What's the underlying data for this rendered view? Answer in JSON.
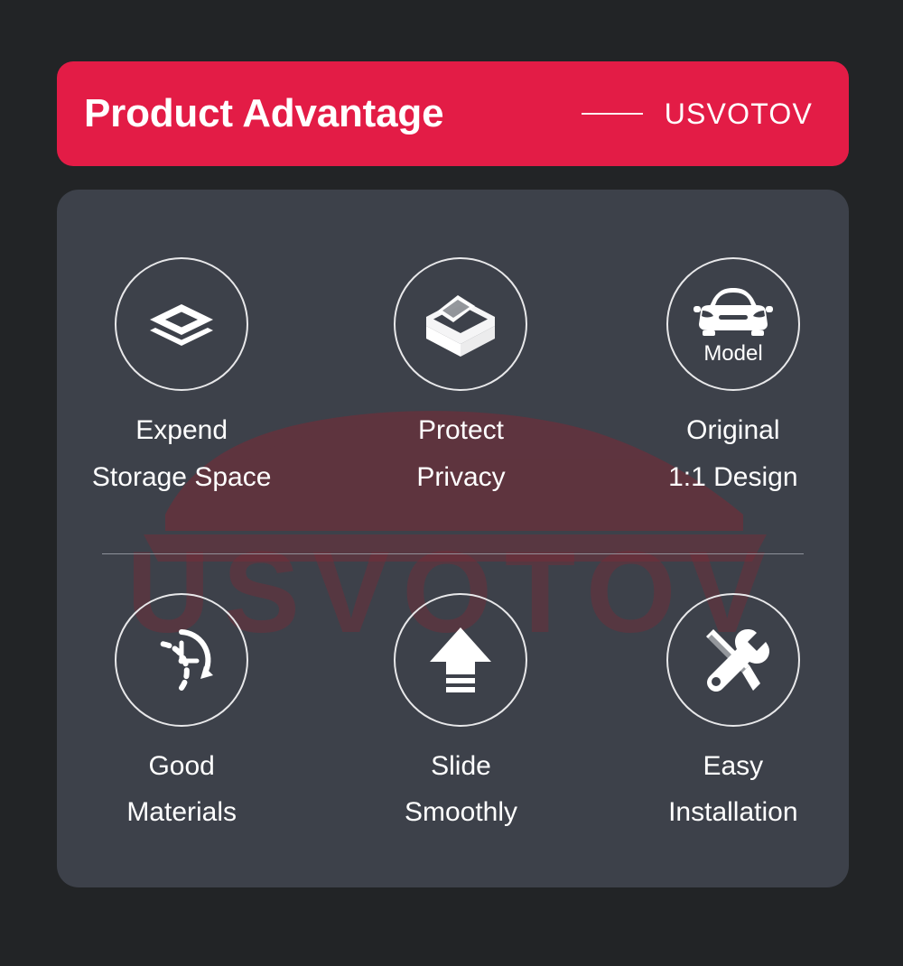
{
  "banner": {
    "title": "Product Advantage",
    "brand": "USVOTOV",
    "separator_icon": "horizontal-dash-icon",
    "background_color": "#E31C46",
    "text_color": "#FFFFFF"
  },
  "card": {
    "background_color": "#3D414A",
    "watermark_text": "USVOTOV",
    "watermark_color": "#6B2430",
    "divider_color": "#9BA0A8"
  },
  "features": [
    {
      "icon": "layers-stack-icon",
      "line1": "Expend",
      "line2": "Storage Space",
      "label": "Expend\nStorage Space"
    },
    {
      "icon": "sliding-box-tray-icon",
      "line1": "Protect",
      "line2": "Privacy",
      "label": "Protect\nPrivacy"
    },
    {
      "icon": "car-model-icon",
      "icon_caption": "Model",
      "line1": "Original",
      "line2": "1:1 Design",
      "label": "Original\n1:1 Design"
    },
    {
      "icon": "clock-durability-icon",
      "line1": "Good",
      "line2": "Materials",
      "label": "Good\nMaterials"
    },
    {
      "icon": "slide-up-arrow-icon",
      "line1": "Slide",
      "line2": "Smoothly",
      "label": "Slide\nSmoothly"
    },
    {
      "icon": "wrench-screwdriver-icon",
      "line1": "Easy",
      "line2": "Installation",
      "label": "Easy\nInstallation"
    }
  ]
}
